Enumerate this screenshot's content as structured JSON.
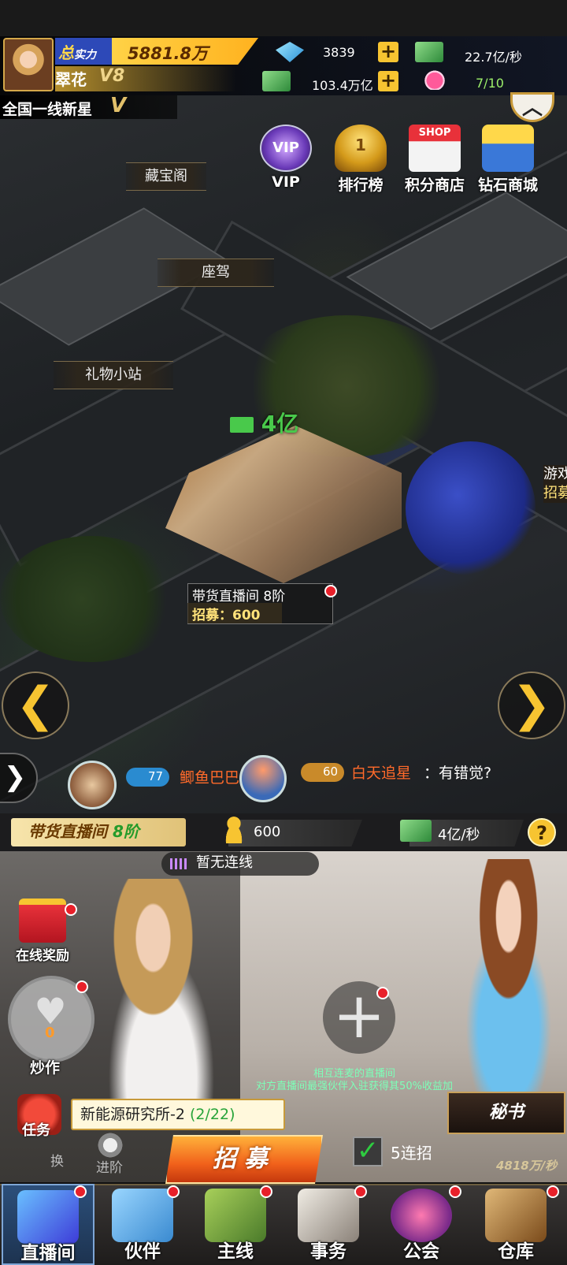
{
  "player": {
    "power_tag": "总",
    "power_tag_sub": "实力",
    "power_value": "5881.8万",
    "name": "翠花",
    "vip": "V8"
  },
  "resources": {
    "diamond": "3839",
    "cash_rate": "22.7亿/秒",
    "cash": "103.4万亿",
    "hearts": "7/10"
  },
  "title": {
    "text": "全国一线新星",
    "badge": "V"
  },
  "top_icons": [
    {
      "label": "VIP"
    },
    {
      "label": "排行榜"
    },
    {
      "label": "积分商店"
    },
    {
      "label": "钻石商城"
    }
  ],
  "icon_texts": {
    "vip_text": "VIP",
    "shop_text": "SHOP",
    "rank_number": "1"
  },
  "building_labels": {
    "treasure": "藏宝阁",
    "car": "座驾",
    "gift_station": "礼物小站",
    "game_partial": "游戏",
    "recruit_partial": "招募"
  },
  "income_float": "4亿",
  "building": {
    "name": "带货直播间 8阶",
    "recruit": "招募：600"
  },
  "chat": {
    "level1": "77",
    "name1": "鲫鱼巴巴",
    "level2": "60",
    "name2": "白天追星",
    "message": "：有错觉?"
  },
  "infobar": {
    "room_name": "带货直播间",
    "room_level": "8阶",
    "fans": "600",
    "rate": "4亿/秒"
  },
  "lower": {
    "link_status": "暂无连线",
    "online_reward": "在线奖励",
    "hype_count": "0",
    "hype_label": "炒作",
    "tip_line1": "相互连麦的直播间",
    "tip_line2": "对方直播间最强伙伴入驻获得其50%收益加",
    "mission_label": "任务",
    "mission_text": "新能源研究所-2",
    "mission_progress": "(2/22)",
    "recruit_button": "招募",
    "five_recruit": "5连招",
    "secretary": "秘书",
    "bottom_rate": "4818万/秒",
    "exchange_partial": "换",
    "advance": "进阶"
  },
  "nav": [
    {
      "label": "直播间",
      "active": true,
      "color": "#3d7bd8"
    },
    {
      "label": "伙伴",
      "active": false,
      "color": "#4aa3e0"
    },
    {
      "label": "主线",
      "active": false,
      "color": "#6ea03a"
    },
    {
      "label": "事务",
      "active": false,
      "color": "#c9c2b8"
    },
    {
      "label": "公会",
      "active": false,
      "color": "#c23c7a"
    },
    {
      "label": "仓库",
      "active": false,
      "color": "#b88a4a"
    }
  ],
  "colors": {
    "accent_gold": "#f7c431",
    "income_green": "#49c94b",
    "chat_orange": "#ff6a2a",
    "badge_red": "#e8202a"
  }
}
